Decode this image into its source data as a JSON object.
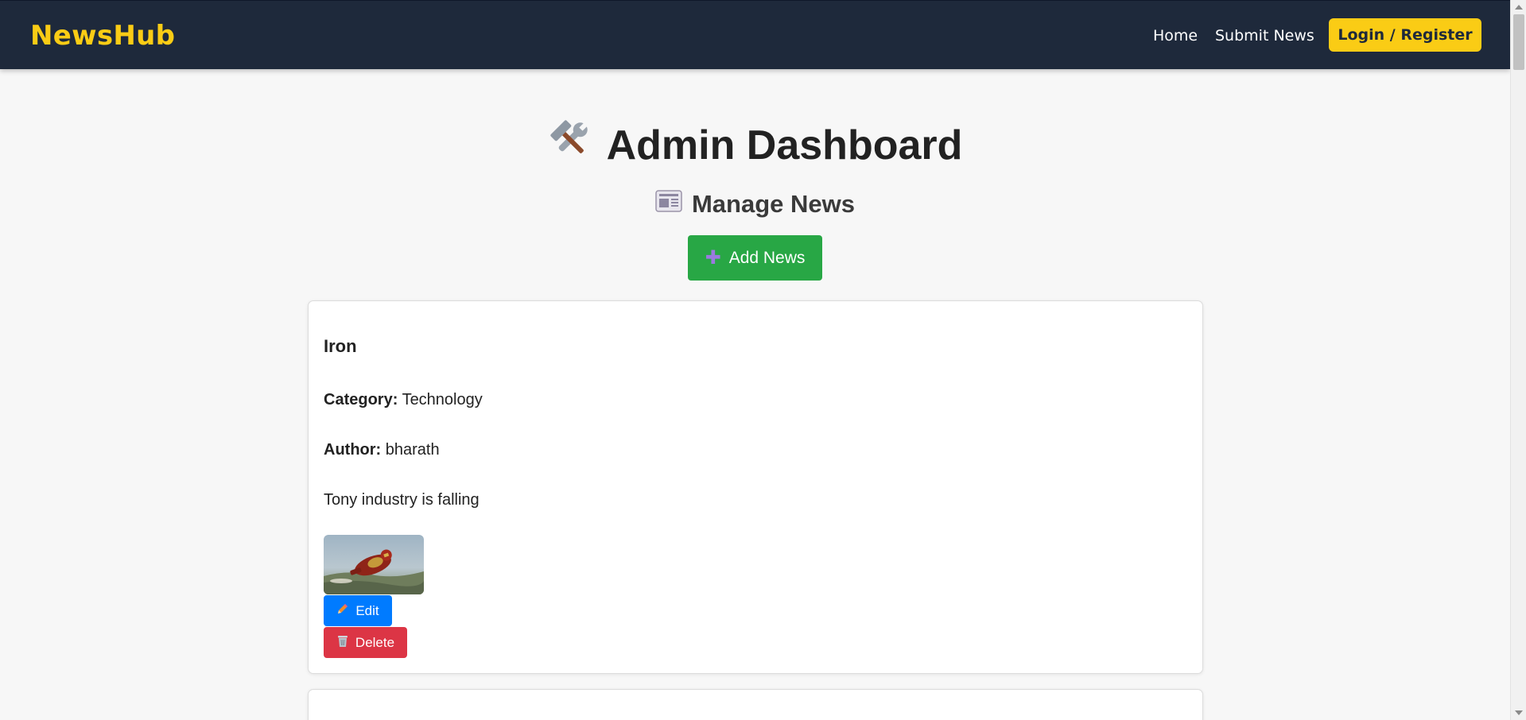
{
  "navbar": {
    "brand": "NewsHub",
    "links": [
      {
        "label": "Home"
      },
      {
        "label": "Submit News"
      }
    ],
    "login_label": "Login / Register",
    "bg_color": "#1e293b",
    "accent_color": "#facc15"
  },
  "header": {
    "title": "Admin Dashboard",
    "title_icon": "hammer-and-wrench-icon",
    "section_title": "Manage News",
    "section_icon": "newspaper-icon"
  },
  "actions": {
    "add_label": "Add News",
    "add_icon": "plus-icon",
    "add_color": "#28a745"
  },
  "news": [
    {
      "title": "Iron",
      "category_label": "Category:",
      "category": "Technology",
      "author_label": "Author:",
      "author": "bharath",
      "description": "Tony industry is falling",
      "image_alt": "iron-man-thumbnail",
      "edit_label": "Edit",
      "edit_icon": "pencil-icon",
      "delete_label": "Delete",
      "delete_icon": "wastebasket-icon"
    }
  ],
  "colors": {
    "edit": "#007bff",
    "delete": "#dc3545",
    "page_bg": "#f7f7f7"
  }
}
